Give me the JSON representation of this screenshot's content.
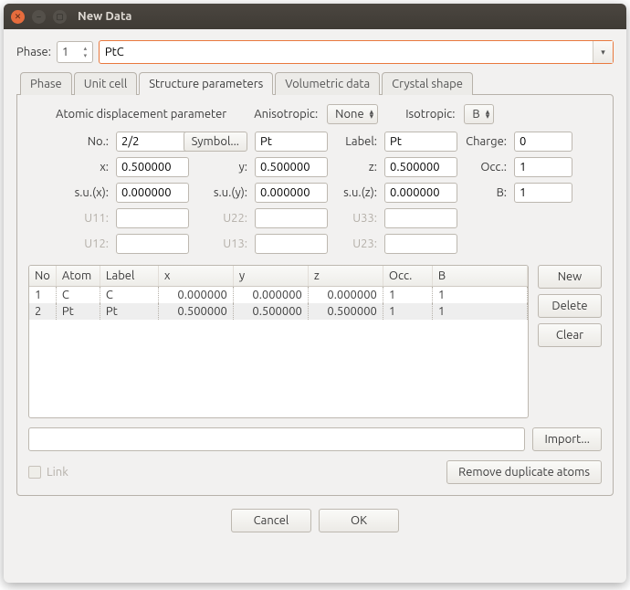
{
  "window": {
    "title": "New Data"
  },
  "phase": {
    "label": "Phase:",
    "number": "1",
    "name": "PtC"
  },
  "tabs": [
    {
      "label": "Phase"
    },
    {
      "label": "Unit cell"
    },
    {
      "label": "Structure parameters"
    },
    {
      "label": "Volumetric data"
    },
    {
      "label": "Crystal shape"
    }
  ],
  "adp": {
    "label": "Atomic displacement parameter",
    "aniso_label": "Anisotropic:",
    "aniso_value": "None",
    "iso_label": "Isotropic:",
    "iso_value": "B"
  },
  "fields": {
    "no_label": "No.:",
    "no_value": "2/2",
    "symbol_label": "Symbol...",
    "symbol_value": "Pt",
    "label_label": "Label:",
    "label_value": "Pt",
    "charge_label": "Charge:",
    "charge_value": "0",
    "x_label": "x:",
    "x_value": "0.500000",
    "y_label": "y:",
    "y_value": "0.500000",
    "z_label": "z:",
    "z_value": "0.500000",
    "occ_label": "Occ.:",
    "occ_value": "1",
    "sux_label": "s.u.(x):",
    "sux_value": "0.000000",
    "suy_label": "s.u.(y):",
    "suy_value": "0.000000",
    "suz_label": "s.u.(z):",
    "suz_value": "0.000000",
    "b_label": "B:",
    "b_value": "1",
    "u11_label": "U11:",
    "u22_label": "U22:",
    "u33_label": "U33:",
    "u12_label": "U12:",
    "u13_label": "U13:",
    "u23_label": "U23:"
  },
  "table": {
    "headers": [
      "No",
      "Atom",
      "Label",
      "x",
      "y",
      "z",
      "Occ.",
      "B"
    ],
    "rows": [
      {
        "no": "1",
        "atom": "C",
        "label": "C",
        "x": "0.000000",
        "y": "0.000000",
        "z": "0.000000",
        "occ": "1",
        "b": "1"
      },
      {
        "no": "2",
        "atom": "Pt",
        "label": "Pt",
        "x": "0.500000",
        "y": "0.500000",
        "z": "0.500000",
        "occ": "1",
        "b": "1"
      }
    ]
  },
  "buttons": {
    "new": "New",
    "delete": "Delete",
    "clear": "Clear",
    "import": "Import...",
    "remove_dup": "Remove duplicate atoms",
    "cancel": "Cancel",
    "ok": "OK"
  },
  "link": {
    "label": "Link"
  }
}
